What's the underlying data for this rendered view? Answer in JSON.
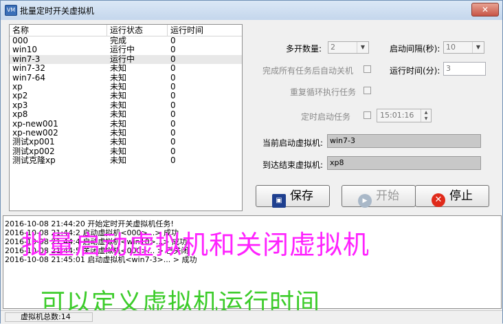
{
  "window": {
    "title": "批量定时开关虚拟机",
    "close_glyph": "✕",
    "app_icon_text": "VM"
  },
  "table": {
    "columns": [
      "名称",
      "运行状态",
      "运行时间"
    ],
    "rows": [
      {
        "name": "000",
        "status": "完成",
        "time": "0"
      },
      {
        "name": "win10",
        "status": "运行中",
        "time": "0"
      },
      {
        "name": "win7-3",
        "status": "运行中",
        "time": "0"
      },
      {
        "name": "win7-32",
        "status": "未知",
        "time": "0"
      },
      {
        "name": "win7-64",
        "status": "未知",
        "time": "0"
      },
      {
        "name": "xp",
        "status": "未知",
        "time": "0"
      },
      {
        "name": "xp2",
        "status": "未知",
        "time": "0"
      },
      {
        "name": "xp3",
        "status": "未知",
        "time": "0"
      },
      {
        "name": "xp8",
        "status": "未知",
        "time": "0"
      },
      {
        "name": "xp-new001",
        "status": "未知",
        "time": "0"
      },
      {
        "name": "xp-new002",
        "status": "未知",
        "time": "0"
      },
      {
        "name": "测试xp001",
        "status": "未知",
        "time": "0"
      },
      {
        "name": "测试xp002",
        "status": "未知",
        "time": "0"
      },
      {
        "name": "测试克隆xp",
        "status": "未知",
        "time": "0"
      }
    ],
    "selected_index": 2
  },
  "settings": {
    "multi_count_label": "多开数量:",
    "multi_count_value": "2",
    "start_interval_label": "启动间隔(秒):",
    "start_interval_value": "10",
    "auto_shutdown_label": "完成所有任务后自动关机",
    "run_time_label": "运行时间(分):",
    "run_time_value": "3",
    "repeat_label": "重复循环执行任务",
    "timed_start_label": "定时启动任务",
    "timed_start_value": "15:01:16",
    "current_vm_label": "当前启动虚拟机:",
    "current_vm_value": "win7-3",
    "end_vm_label": "到达结束虚拟机:",
    "end_vm_value": "xp8"
  },
  "buttons": {
    "save": "保存",
    "start": "开始",
    "stop": "停止"
  },
  "log": [
    "2016-10-08 21:44:20 开始定时开关虚拟机任务!",
    "2016-10-08 21:44:2 启动虚拟机<000>...> 成功",
    "2016-10-08 21:44:4 启动虚拟机<win10>...> 成功",
    "2016-10-08 21:44:5 关闭虚拟机<000>... > 已关闭",
    "2016-10-08 21:45:01 启动虚拟机<win7-3>... > 成功"
  ],
  "overlay": {
    "line1": "批量启动虚拟机和关闭虚拟机",
    "line2": "可以定义虚拟机运行时间"
  },
  "status": {
    "vm_count": "虚拟机总数:14"
  },
  "colors": {
    "overlay_line1": "#ff22ff",
    "overlay_line2": "#3ccc2a",
    "stop_icon": "#e02a1a",
    "start_icon": "#a9b8c8",
    "save_icon": "#1e3f8f"
  }
}
